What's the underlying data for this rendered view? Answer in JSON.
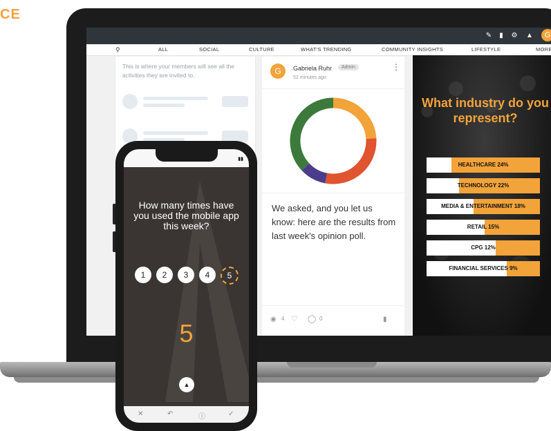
{
  "brand": {
    "partial_text": "CE",
    "color": "#F2A33A"
  },
  "topbar": {
    "icons": [
      "edit-icon",
      "bar-chart-icon",
      "gear-icon",
      "bell-icon"
    ],
    "avatar_initial": "G"
  },
  "nav": {
    "items": [
      "ALL",
      "SOCIAL",
      "CULTURE",
      "WHAT'S TRENDING",
      "COMMUNITY INSIGHTS",
      "LIFESTYLE",
      "MORE"
    ]
  },
  "left_card": {
    "intro": "This is where your members will see all the activities they are invited to."
  },
  "post": {
    "avatar_initial": "G",
    "author": "Gabriela Ruhr",
    "badge": "Admin",
    "time": "52 minutes ago",
    "text": "We asked, and you let us know: here are the results from last week's opinion poll.",
    "views": "4",
    "comments": "0"
  },
  "donut": {
    "segments": [
      {
        "value": 24,
        "color": "#F2A33A"
      },
      {
        "value": 29,
        "color": "#E0542F"
      },
      {
        "value": 10,
        "color": "#4B3C8C"
      },
      {
        "value": 37,
        "color": "#3B7A3B"
      }
    ]
  },
  "poll": {
    "title": "What industry do you represent?",
    "results": [
      {
        "label": "HEALTHCARE",
        "percent": "24%",
        "value": 24
      },
      {
        "label": "TECHNOLOGY",
        "percent": "22%",
        "value": 22
      },
      {
        "label": "MEDIA & ENTERTAINMENT",
        "percent": "18%",
        "value": 18
      },
      {
        "label": "RETAIL",
        "percent": "15%",
        "value": 15
      },
      {
        "label": "CPG",
        "percent": "12%",
        "value": 12
      },
      {
        "label": "FINANCIAL SERVICES",
        "percent": "9%",
        "value": 9
      }
    ],
    "accent": "#F2A33A"
  },
  "phone": {
    "question": "How many times have you used the mobile app this week?",
    "options": [
      "1",
      "2",
      "3",
      "4",
      "5"
    ],
    "selected": "5",
    "value": "5",
    "bottom_icons": [
      "close-icon",
      "back-icon",
      "info-icon",
      "check-icon"
    ]
  }
}
